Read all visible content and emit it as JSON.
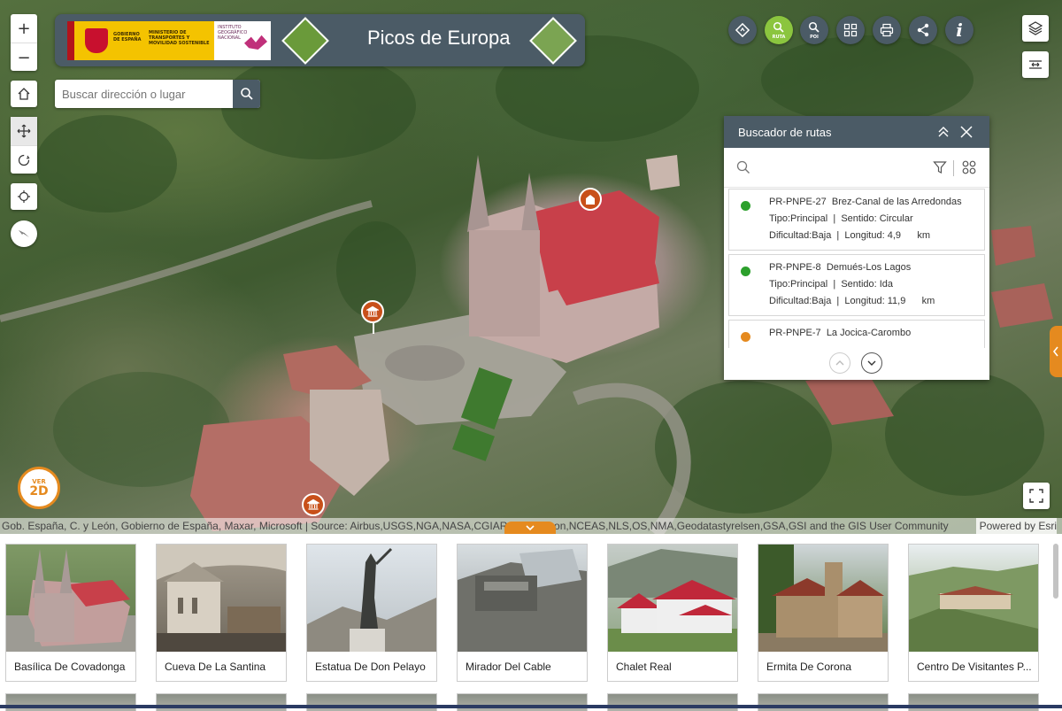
{
  "header": {
    "title": "Picos de Europa",
    "gov_line1": "GOBIERNO DE ESPAÑA",
    "gov_line2": "MINISTERIO DE TRANSPORTES Y MOVILIDAD SOSTENIBLE",
    "ign_text": "INSTITUTO GEOGRÁFICO NACIONAL"
  },
  "search": {
    "placeholder": "Buscar dirección o lugar"
  },
  "zoom": {
    "in": "+",
    "out": "−"
  },
  "toolbar": {
    "ruta_label": "RUTA",
    "poi_label": "POI",
    "info_label": "i"
  },
  "view_toggle": {
    "top": "VER",
    "main": "2D"
  },
  "attribution": {
    "left": "Gob. España, C. y León, Gobierno de España, Maxar, Microsoft | Source: Airbus,USGS,NGA,NASA,CGIAR,N Robinson,NCEAS,NLS,OS,NMA,Geodatastyrelsen,GSA,GSI and the GIS User Community",
    "right": "Powered by Esri"
  },
  "route_panel": {
    "title": "Buscador de rutas",
    "routes": [
      {
        "code": "PR-PNPE-27",
        "name": "Brez-Canal de las Arredondas",
        "line2": "Tipo:Principal  |  Sentido: Circular",
        "line3": "Dificultad:Baja  |  Longitud: 4,9      km",
        "color": "#2ca02c"
      },
      {
        "code": "PR-PNPE-8",
        "name": "Demués-Los Lagos",
        "line2": "Tipo:Principal  |  Sentido: Ida",
        "line3": "Dificultad:Baja  |  Longitud: 11,9      km",
        "color": "#2ca02c"
      },
      {
        "code": "PR-PNPE-7",
        "name": "La Jocica-Carombo",
        "line2": "",
        "line3": "",
        "color": "#e58a1f"
      }
    ]
  },
  "gallery": {
    "items": [
      {
        "label": "Basílica De Covadonga"
      },
      {
        "label": "Cueva De La Santina"
      },
      {
        "label": "Estatua De Don Pelayo"
      },
      {
        "label": "Mirador Del Cable"
      },
      {
        "label": "Chalet Real"
      },
      {
        "label": "Ermita De Corona"
      },
      {
        "label": "Centro De Visitantes P..."
      }
    ]
  },
  "colors": {
    "header_bg": "#4b5b66",
    "accent_orange": "#e58a1f",
    "poi_marker": "#c8501a"
  }
}
